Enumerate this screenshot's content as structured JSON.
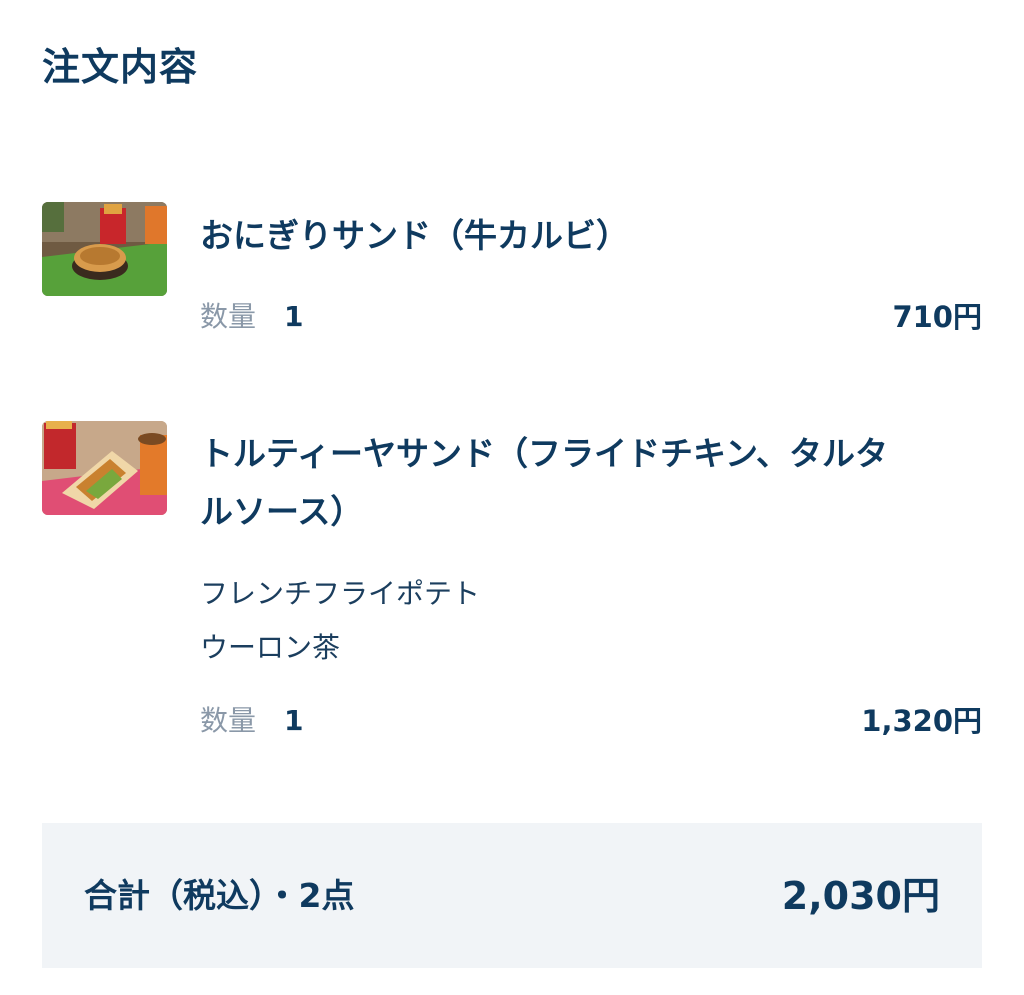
{
  "header": {
    "title": "注文内容"
  },
  "items": [
    {
      "name": "おにぎりサンド（牛カルビ）",
      "image": "onigiri-sandwich-photo",
      "options": [],
      "quantity_label": "数量",
      "quantity": "1",
      "price": "710円"
    },
    {
      "name_line1": "トルティーヤサンド（フライドチキン、タルタ",
      "name_line2": "ルソース）",
      "image": "tortilla-sandwich-photo",
      "options": [
        "フレンチフライポテト",
        "ウーロン茶"
      ],
      "quantity_label": "数量",
      "quantity": "1",
      "price": "1,320円"
    }
  ],
  "summary": {
    "total_label": "合計（税込）・2点",
    "total_amount": "2,030円"
  }
}
